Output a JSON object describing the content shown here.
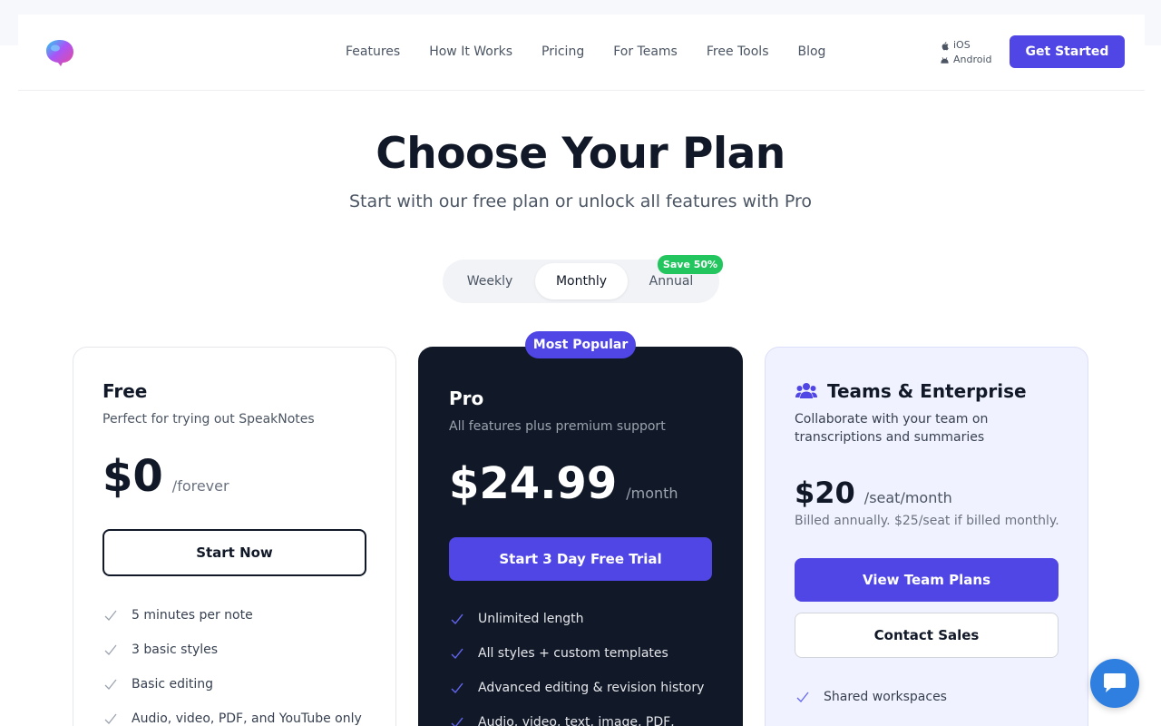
{
  "nav": {
    "links": [
      "Features",
      "How It Works",
      "Pricing",
      "For Teams",
      "Free Tools",
      "Blog"
    ],
    "platforms": {
      "ios": "iOS",
      "android": "Android"
    },
    "cta": "Get Started"
  },
  "hero": {
    "title": "Choose Your Plan",
    "subtitle": "Start with our free plan or unlock all features with Pro"
  },
  "billing": {
    "options": [
      "Weekly",
      "Monthly",
      "Annual"
    ],
    "selected": "Monthly",
    "annual_badge": "Save 50%"
  },
  "plans": {
    "free": {
      "name": "Free",
      "desc": "Perfect for trying out SpeakNotes",
      "price": "$0",
      "period": "/forever",
      "cta": "Start Now",
      "features": [
        "5 minutes per note",
        "3 basic styles",
        "Basic editing",
        "Audio, video, PDF, and YouTube only"
      ]
    },
    "pro": {
      "badge": "Most Popular",
      "name": "Pro",
      "desc": "All features plus premium support",
      "price": "$24.99",
      "period": "/month",
      "cta": "Start 3 Day Free Trial",
      "features": [
        "Unlimited length",
        "All styles + custom templates",
        "Advanced editing & revision history",
        "Audio, video, text, image, PDF,"
      ]
    },
    "teams": {
      "name": "Teams & Enterprise",
      "desc": "Collaborate with your team on transcriptions and summaries",
      "price": "$20",
      "period": "/seat/month",
      "billing_note": "Billed annually. $25/seat if billed monthly.",
      "cta_primary": "View Team Plans",
      "cta_secondary": "Contact Sales",
      "features": [
        "Shared workspaces"
      ]
    }
  },
  "colors": {
    "accent": "#4f46e5",
    "dark_card": "#111827",
    "badge_green": "#22c55e",
    "chat": "#2f7fe0"
  }
}
